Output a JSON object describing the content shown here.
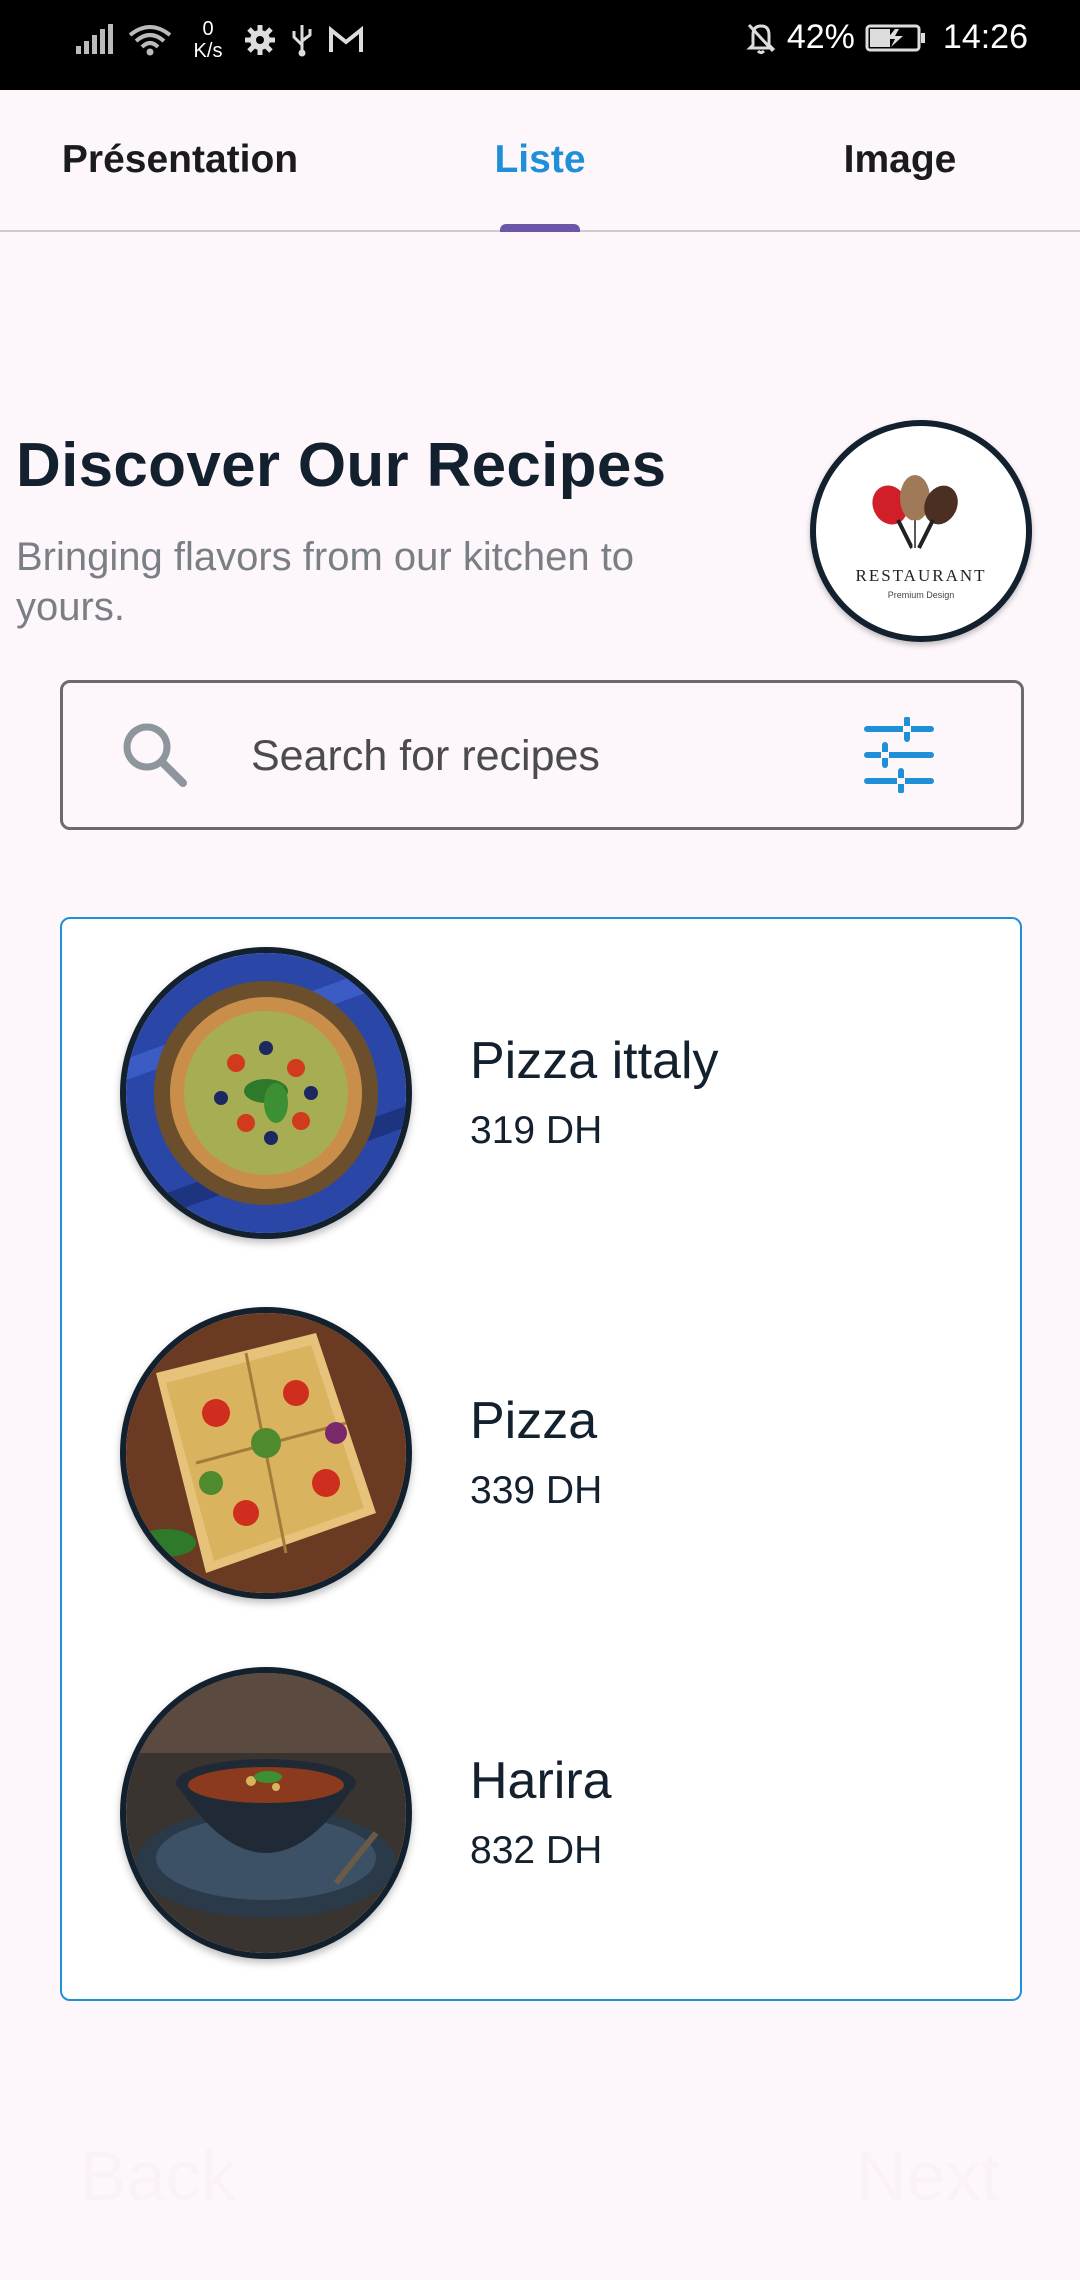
{
  "status_bar": {
    "netspeed_value": "0",
    "netspeed_unit": "K/s",
    "battery": "42%",
    "time": "14:26"
  },
  "tabs": [
    {
      "label": "Présentation"
    },
    {
      "label": "Liste"
    },
    {
      "label": "Image"
    }
  ],
  "active_tab": "Liste",
  "header": {
    "title": "Discover Our Recipes",
    "subtitle": "Bringing flavors from our kitchen to yours.",
    "logo_text": "RESTAURANT",
    "logo_subtext": "Premium Design"
  },
  "search": {
    "placeholder": "Search for recipes"
  },
  "recipes": [
    {
      "name": "Pizza ittaly",
      "price": "319 DH"
    },
    {
      "name": "Pizza",
      "price": "339 DH"
    },
    {
      "name": "Harira",
      "price": "832 DH"
    }
  ],
  "footer": {
    "back_label": "Back",
    "next_label": "Next"
  },
  "colors": {
    "accent": "#1f8fd8",
    "indicator": "#6b56a8",
    "title": "#13202e",
    "background": "#fdf7fc"
  }
}
